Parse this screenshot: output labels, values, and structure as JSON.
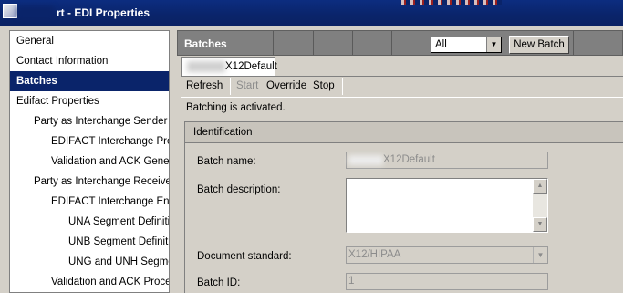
{
  "window": {
    "title": "rt - EDI Properties"
  },
  "sidebar": {
    "items": [
      {
        "label": "General",
        "indent": 0
      },
      {
        "label": "Contact Information",
        "indent": 0
      },
      {
        "label": "Batches",
        "indent": 0,
        "selected": true
      },
      {
        "label": "Edifact Properties",
        "indent": 0
      },
      {
        "label": "Party as Interchange Sender",
        "indent": 1
      },
      {
        "label": "EDIFACT Interchange Proc",
        "indent": 2
      },
      {
        "label": "Validation and ACK Genera",
        "indent": 2
      },
      {
        "label": "Party as Interchange Receiver",
        "indent": 1
      },
      {
        "label": "EDIFACT Interchange Env",
        "indent": 2
      },
      {
        "label": "UNA Segment Definitio",
        "indent": 3
      },
      {
        "label": "UNB Segment Definitio",
        "indent": 3
      },
      {
        "label": "UNG and UNH Segme",
        "indent": 3
      },
      {
        "label": "Validation and ACK Proces",
        "indent": 2
      }
    ]
  },
  "main": {
    "header_title": "Batches",
    "filter_value": "All",
    "new_batch_label": "New Batch",
    "tab_label": "X12Default",
    "toolbar": {
      "refresh": "Refresh",
      "start": "Start",
      "override": "Override",
      "stop": "Stop"
    },
    "status_text": "Batching is activated.",
    "section_title": "Identification",
    "fields": {
      "batch_name_label": "Batch name:",
      "batch_name_value": "X12Default",
      "batch_description_label": "Batch description:",
      "batch_description_value": "",
      "document_standard_label": "Document standard:",
      "document_standard_value": "X12/HIPAA",
      "batch_id_label": "Batch ID:",
      "batch_id_value": "1"
    }
  },
  "colors": {
    "title_bar": "#0a246a",
    "selection": "#0a246a",
    "dialog_face": "#d4d0c8",
    "header_bar": "#808080"
  }
}
